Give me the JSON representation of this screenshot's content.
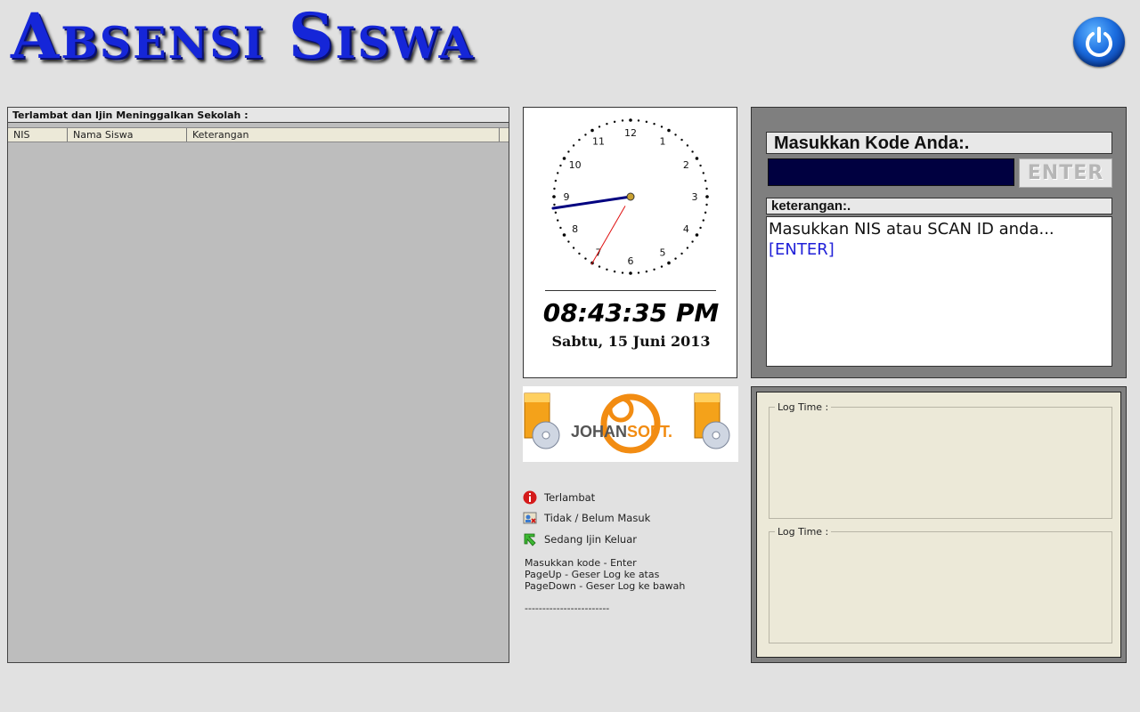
{
  "header": {
    "title": "Absensi Siswa",
    "power_icon": "power-icon"
  },
  "late_panel": {
    "caption": "Terlambat dan Ijin Meninggalkan Sekolah :",
    "columns": [
      "NIS",
      "Nama Siswa",
      "Keterangan"
    ]
  },
  "clock": {
    "face_numbers": [
      "12",
      "1",
      "2",
      "3",
      "4",
      "5",
      "6",
      "7",
      "8",
      "9",
      "10",
      "11"
    ],
    "hour": 8,
    "minute": 43,
    "second": 35,
    "time_text": "08:43:35 PM",
    "date_text": "Sabtu, 15 Juni 2013"
  },
  "logo": {
    "brand_part1": "JOHAN",
    "brand_part2": "SOFT."
  },
  "legend": {
    "items": [
      {
        "label": "Terlambat",
        "icon": "info-red-icon"
      },
      {
        "label": "Tidak / Belum Masuk",
        "icon": "person-x-icon"
      },
      {
        "label": "Sedang Ijin Keluar",
        "icon": "green-arrow-icon"
      }
    ],
    "hotkeys": "Masukkan kode - Enter\nPageUp - Geser Log ke atas\nPageDown - Geser Log ke bawah",
    "dashes": "------------------------"
  },
  "input_panel": {
    "code_label": "Masukkan Kode Anda:.",
    "code_value": "",
    "enter_label": "ENTER",
    "ket_label": "keterangan:.",
    "ket_message": "Masukkan NIS atau SCAN ID anda...",
    "ket_enter": "[ENTER]"
  },
  "log_panel": {
    "boxes": [
      {
        "legend": "Log Time :"
      },
      {
        "legend": "Log Time :"
      }
    ]
  },
  "colors": {
    "title": "#1526d8",
    "code_input_bg": "#000040",
    "ket_enter": "#2020d8",
    "panel_grey": "#808080",
    "log_bg": "#ece9d8"
  }
}
